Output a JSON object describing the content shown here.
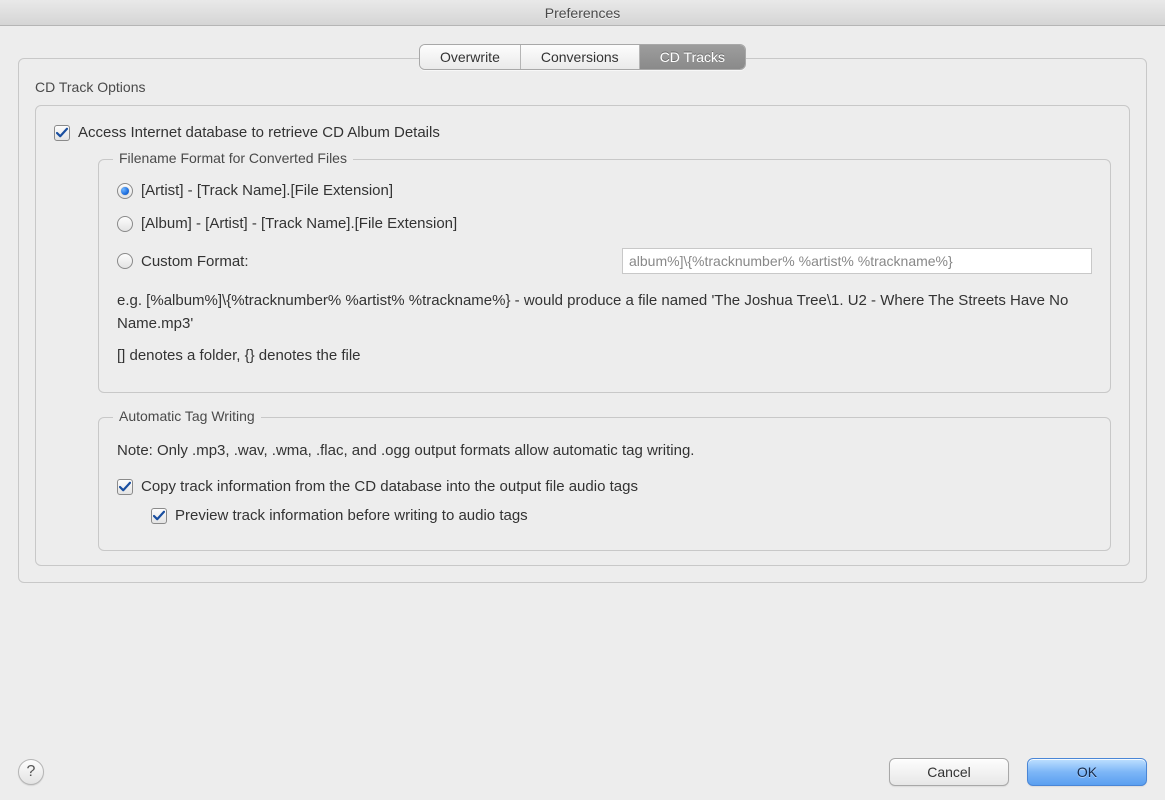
{
  "window": {
    "title": "Preferences"
  },
  "tabs": {
    "items": [
      {
        "label": "Overwrite",
        "active": false
      },
      {
        "label": "Conversions",
        "active": false
      },
      {
        "label": "CD Tracks",
        "active": true
      }
    ]
  },
  "panel": {
    "group_label": "CD Track Options",
    "access_db": {
      "checked": true,
      "label": "Access Internet database to retrieve CD Album Details"
    },
    "filename_format": {
      "legend": "Filename Format for Converted Files",
      "options": [
        {
          "label": "[Artist] - [Track Name].[File Extension]",
          "selected": true
        },
        {
          "label": "[Album] - [Artist] - [Track Name].[File Extension]",
          "selected": false
        },
        {
          "label": "Custom Format:",
          "selected": false
        }
      ],
      "custom_value": "album%]\\{%tracknumber% %artist% %trackname%}",
      "example": "e.g. [%album%]\\{%tracknumber% %artist% %trackname%} - would produce a file named 'The Joshua Tree\\1. U2 - Where The Streets Have No Name.mp3'",
      "notation": "[] denotes a folder, {} denotes the file"
    },
    "tag_writing": {
      "legend": "Automatic Tag Writing",
      "note": "Note: Only .mp3, .wav, .wma, .flac, and .ogg output formats allow automatic tag writing.",
      "copy_tags": {
        "checked": true,
        "label": "Copy track information from the CD database into the output file audio tags"
      },
      "preview": {
        "checked": true,
        "label": "Preview track information before writing to audio tags"
      }
    }
  },
  "footer": {
    "help": "?",
    "cancel": "Cancel",
    "ok": "OK"
  }
}
